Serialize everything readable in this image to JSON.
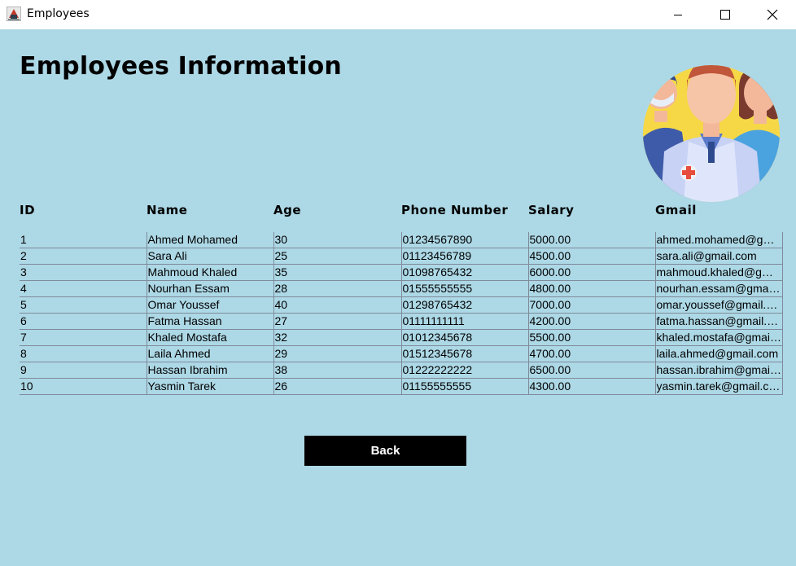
{
  "window": {
    "title": "Employees"
  },
  "page": {
    "title": "Employees Information"
  },
  "table": {
    "headers": [
      "ID",
      "Name",
      "Age",
      "Phone Number",
      "Salary",
      "Gmail"
    ],
    "rows": [
      [
        "1",
        "Ahmed Mohamed",
        "30",
        "01234567890",
        "5000.00",
        "ahmed.mohamed@gmail.com"
      ],
      [
        "2",
        "Sara Ali",
        "25",
        "01123456789",
        "4500.00",
        "sara.ali@gmail.com"
      ],
      [
        "3",
        "Mahmoud Khaled",
        "35",
        "01098765432",
        "6000.00",
        "mahmoud.khaled@gmail.com"
      ],
      [
        "4",
        "Nourhan Essam",
        "28",
        "01555555555",
        "4800.00",
        "nourhan.essam@gmail.com"
      ],
      [
        "5",
        "Omar Youssef",
        "40",
        "01298765432",
        "7000.00",
        "omar.youssef@gmail.com"
      ],
      [
        "6",
        "Fatma Hassan",
        "27",
        "01111111111",
        "4200.00",
        "fatma.hassan@gmail.com"
      ],
      [
        "7",
        "Khaled Mostafa",
        "32",
        "01012345678",
        "5500.00",
        "khaled.mostafa@gmail.com"
      ],
      [
        "8",
        "Laila Ahmed",
        "29",
        "01512345678",
        "4700.00",
        "laila.ahmed@gmail.com"
      ],
      [
        "9",
        "Hassan Ibrahim",
        "38",
        "01222222222",
        "6500.00",
        "hassan.ibrahim@gmail.com"
      ],
      [
        "10",
        "Yasmin Tarek",
        "26",
        "01155555555",
        "4300.00",
        "yasmin.tarek@gmail.com"
      ]
    ]
  },
  "actions": {
    "back_label": "Back"
  },
  "icons": {
    "app": "java-app-icon",
    "minimize": "minimize-icon",
    "maximize": "maximize-icon",
    "close": "close-icon",
    "illustration": "medical-staff-illustration"
  },
  "colors": {
    "background": "#add8e6",
    "button": "#000000",
    "button_text": "#ffffff"
  }
}
